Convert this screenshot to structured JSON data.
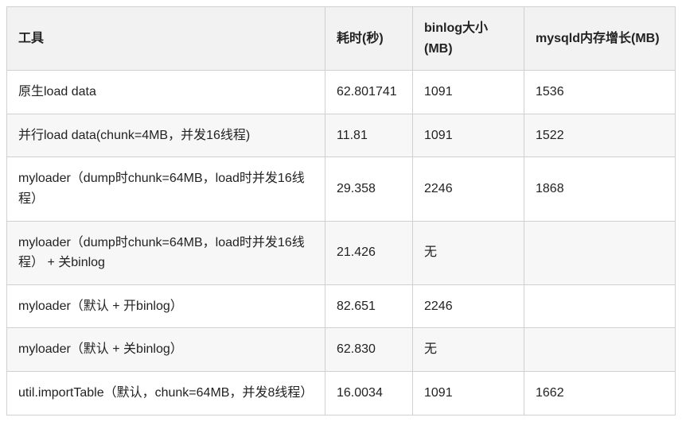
{
  "table": {
    "headers": [
      "工具",
      "耗时(秒)",
      "binlog大小(MB)",
      "mysqld内存增长(MB)"
    ],
    "rows": [
      {
        "tool": "原生load data",
        "time": "62.801741",
        "binlog": "1091",
        "mem": "1536"
      },
      {
        "tool": "并行load data(chunk=4MB，并发16线程)",
        "time": "11.81",
        "binlog": "1091",
        "mem": "1522"
      },
      {
        "tool": "myloader（dump时chunk=64MB，load时并发16线程）",
        "time": "29.358",
        "binlog": "2246",
        "mem": "1868"
      },
      {
        "tool": "myloader（dump时chunk=64MB，load时并发16线程） + 关binlog",
        "time": "21.426",
        "binlog": "无",
        "mem": ""
      },
      {
        "tool": "myloader（默认 + 开binlog）",
        "time": "82.651",
        "binlog": "2246",
        "mem": ""
      },
      {
        "tool": "myloader（默认 + 关binlog）",
        "time": "62.830",
        "binlog": "无",
        "mem": ""
      },
      {
        "tool": "util.importTable（默认，chunk=64MB，并发8线程）",
        "time": "16.0034",
        "binlog": "1091",
        "mem": "1662"
      }
    ]
  }
}
